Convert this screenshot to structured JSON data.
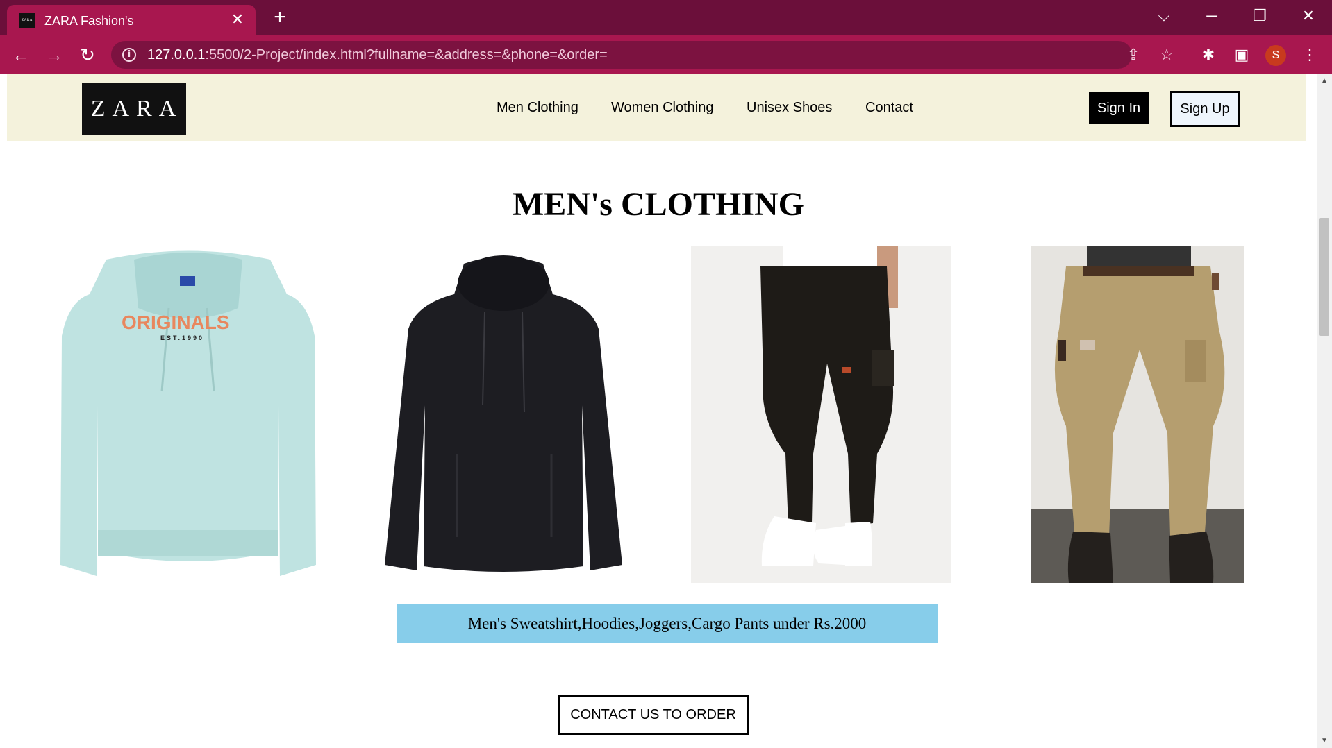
{
  "browser": {
    "tab_title": "ZARA Fashion's",
    "tab_favicon_text": "ZARA",
    "url_host": "127.0.0.1",
    "url_rest": ":5500/2-Project/index.html?fullname=&address=&phone=&order=",
    "profile_initial": "S",
    "icons": [
      "back-arrow-icon",
      "forward-arrow-icon",
      "reload-icon",
      "info-icon",
      "share-icon",
      "star-icon",
      "puzzle-icon",
      "side-panel-icon",
      "kebab-menu-icon",
      "close-icon",
      "plus-icon",
      "chevron-down-icon",
      "minimize-icon",
      "restore-icon"
    ]
  },
  "header": {
    "logo": "ZARA",
    "nav": [
      {
        "label": "Men Clothing"
      },
      {
        "label": "Women Clothing"
      },
      {
        "label": "Unisex Shoes"
      },
      {
        "label": "Contact"
      }
    ],
    "signin": "Sign In",
    "signup": "Sign Up"
  },
  "main": {
    "title": "MEN's CLOTHING",
    "products": [
      {
        "name": "mint-hoodie",
        "print": "ORIGINALS",
        "sub": "EST.1990",
        "color": "#bfe3e1"
      },
      {
        "name": "black-cowl-sweatshirt",
        "color": "#1d1d22"
      },
      {
        "name": "black-joggers",
        "color": "#1e1b17"
      },
      {
        "name": "khaki-cargo-pants",
        "color": "#b59e6f"
      }
    ],
    "caption": "Men's Sweatshirt,Hoodies,Joggers,Cargo Pants under Rs.2000",
    "order_button": "CONTACT US TO ORDER"
  }
}
